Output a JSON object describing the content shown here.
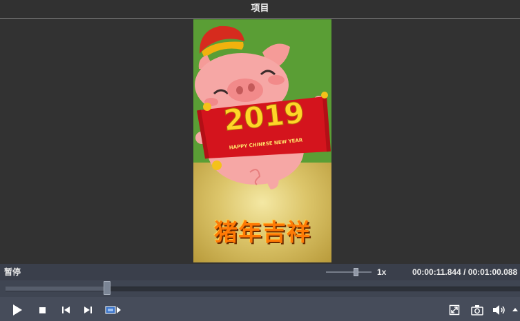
{
  "window": {
    "title": "项目"
  },
  "video": {
    "year_text": "2019",
    "banner_subtitle": "HAPPY CHINESE NEW YEAR",
    "greeting": "猪年吉祥"
  },
  "player": {
    "state_label": "暂停",
    "speed_label": "1x",
    "current_time": "00:00:11.844",
    "time_separator": "/",
    "total_time": "00:01:00.088",
    "progress_fraction": 0.197
  },
  "controls": {
    "icons": [
      "play-icon",
      "stop-icon",
      "skip-back-icon",
      "skip-forward-icon",
      "frame-step-icon",
      "fullscreen-icon",
      "snapshot-icon",
      "volume-icon",
      "volume-dropdown-icon"
    ]
  }
}
